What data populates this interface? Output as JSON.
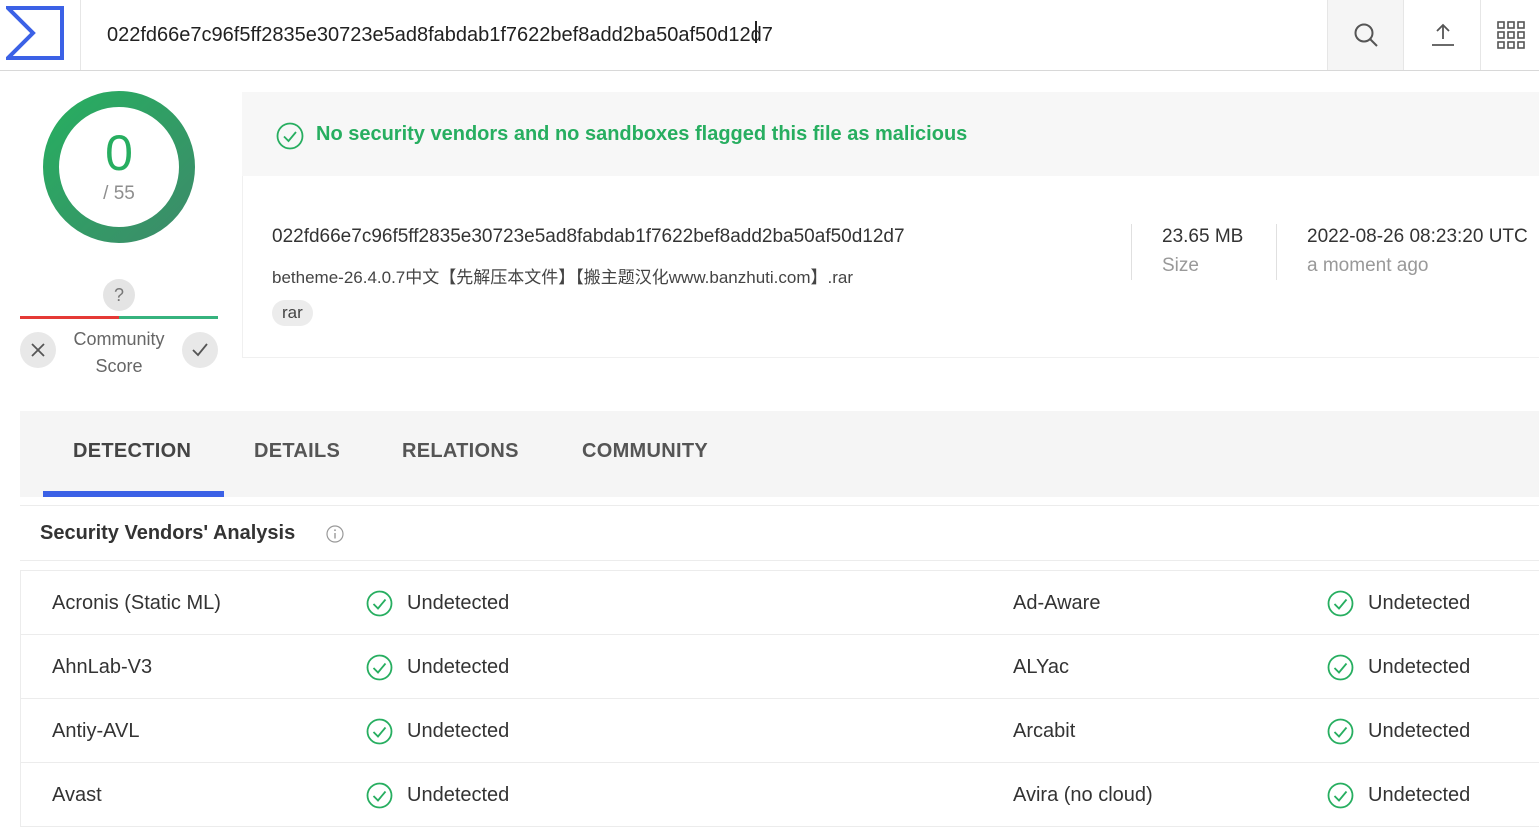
{
  "search": {
    "value": "022fd66e7c96f5ff2835e30723e5ad8fabdab1f7622bef8add2ba50af50d12d7",
    "icons": [
      "search-icon",
      "upload-icon",
      "apps-grid-icon"
    ]
  },
  "score": {
    "detections": "0",
    "total": "/ 55",
    "community_unknown": "?",
    "community_label": "Community Score"
  },
  "banner": {
    "text": "No security vendors and no sandboxes flagged this file as malicious"
  },
  "file": {
    "hash": "022fd66e7c96f5ff2835e30723e5ad8fabdab1f7622bef8add2ba50af50d12d7",
    "name": "betheme-26.4.0.7中文【先解压本文件】【搬主题汉化www.banzhuti.com】.rar",
    "tag": "rar",
    "size": "23.65 MB",
    "size_label": "Size",
    "date": "2022-08-26 08:23:20 UTC",
    "date_relative": "a moment ago"
  },
  "tabs": [
    {
      "label": "DETECTION",
      "active": true
    },
    {
      "label": "DETAILS",
      "active": false
    },
    {
      "label": "RELATIONS",
      "active": false
    },
    {
      "label": "COMMUNITY",
      "active": false
    }
  ],
  "vendors": {
    "title": "Security Vendors' Analysis",
    "rows": [
      {
        "left": {
          "name": "Acronis (Static ML)",
          "result": "Undetected"
        },
        "right": {
          "name": "Ad-Aware",
          "result": "Undetected"
        }
      },
      {
        "left": {
          "name": "AhnLab-V3",
          "result": "Undetected"
        },
        "right": {
          "name": "ALYac",
          "result": "Undetected"
        }
      },
      {
        "left": {
          "name": "Antiy-AVL",
          "result": "Undetected"
        },
        "right": {
          "name": "Arcabit",
          "result": "Undetected"
        }
      },
      {
        "left": {
          "name": "Avast",
          "result": "Undetected"
        },
        "right": {
          "name": "Avira (no cloud)",
          "result": "Undetected"
        }
      }
    ]
  },
  "colors": {
    "accent": "#3b61e6",
    "clean": "#27ae60",
    "negative": "#e53935"
  }
}
